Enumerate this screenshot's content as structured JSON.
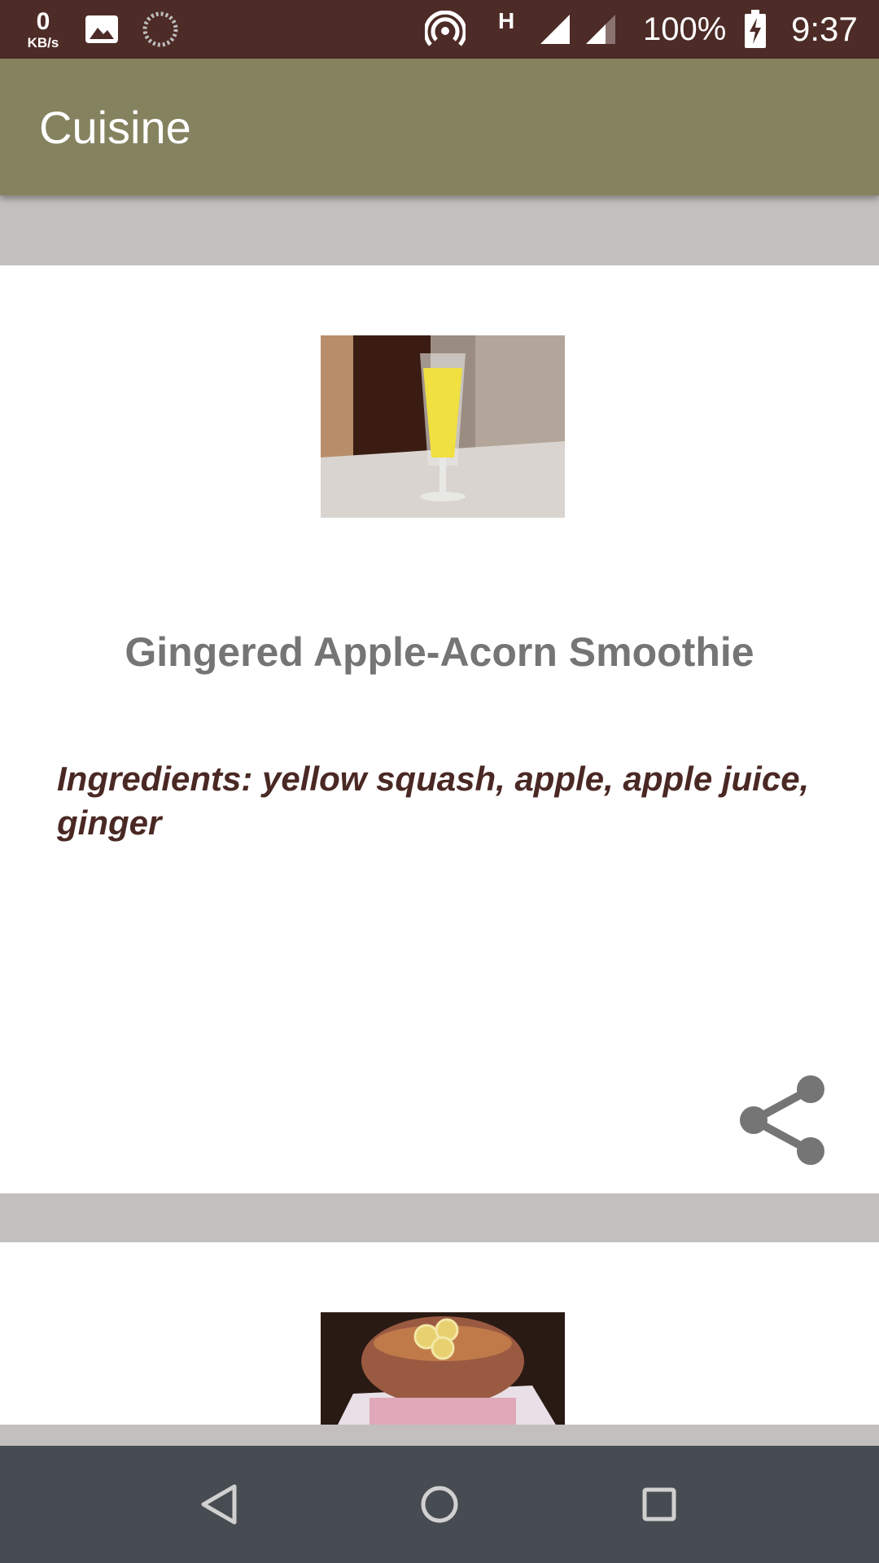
{
  "status_bar": {
    "net_speed_value": "0",
    "net_speed_unit": "KB/s",
    "network_type": "H",
    "battery_percent": "100%",
    "time": "9:37",
    "icons": [
      "gallery-icon",
      "sync-icon",
      "hotspot-icon",
      "signal-icon",
      "signal-icon",
      "battery-charging-icon"
    ]
  },
  "app_bar": {
    "title": "Cuisine",
    "color": "#85825f"
  },
  "recipes": [
    {
      "image": "smoothie-photo",
      "title": "Gingered Apple-Acorn Smoothie",
      "ingredients": "Ingredients: yellow squash, apple, apple juice, ginger",
      "action_icon": "share-icon"
    },
    {
      "image": "soup-photo"
    }
  ],
  "nav_bar": {
    "icons": [
      "back-icon",
      "home-icon",
      "recent-apps-icon"
    ]
  },
  "colors": {
    "status_bar": "#4d2b26",
    "background": "#c3bfbf",
    "title_text": "#757575",
    "ingredients_text": "#4a2824",
    "nav_bar": "#474c52"
  }
}
